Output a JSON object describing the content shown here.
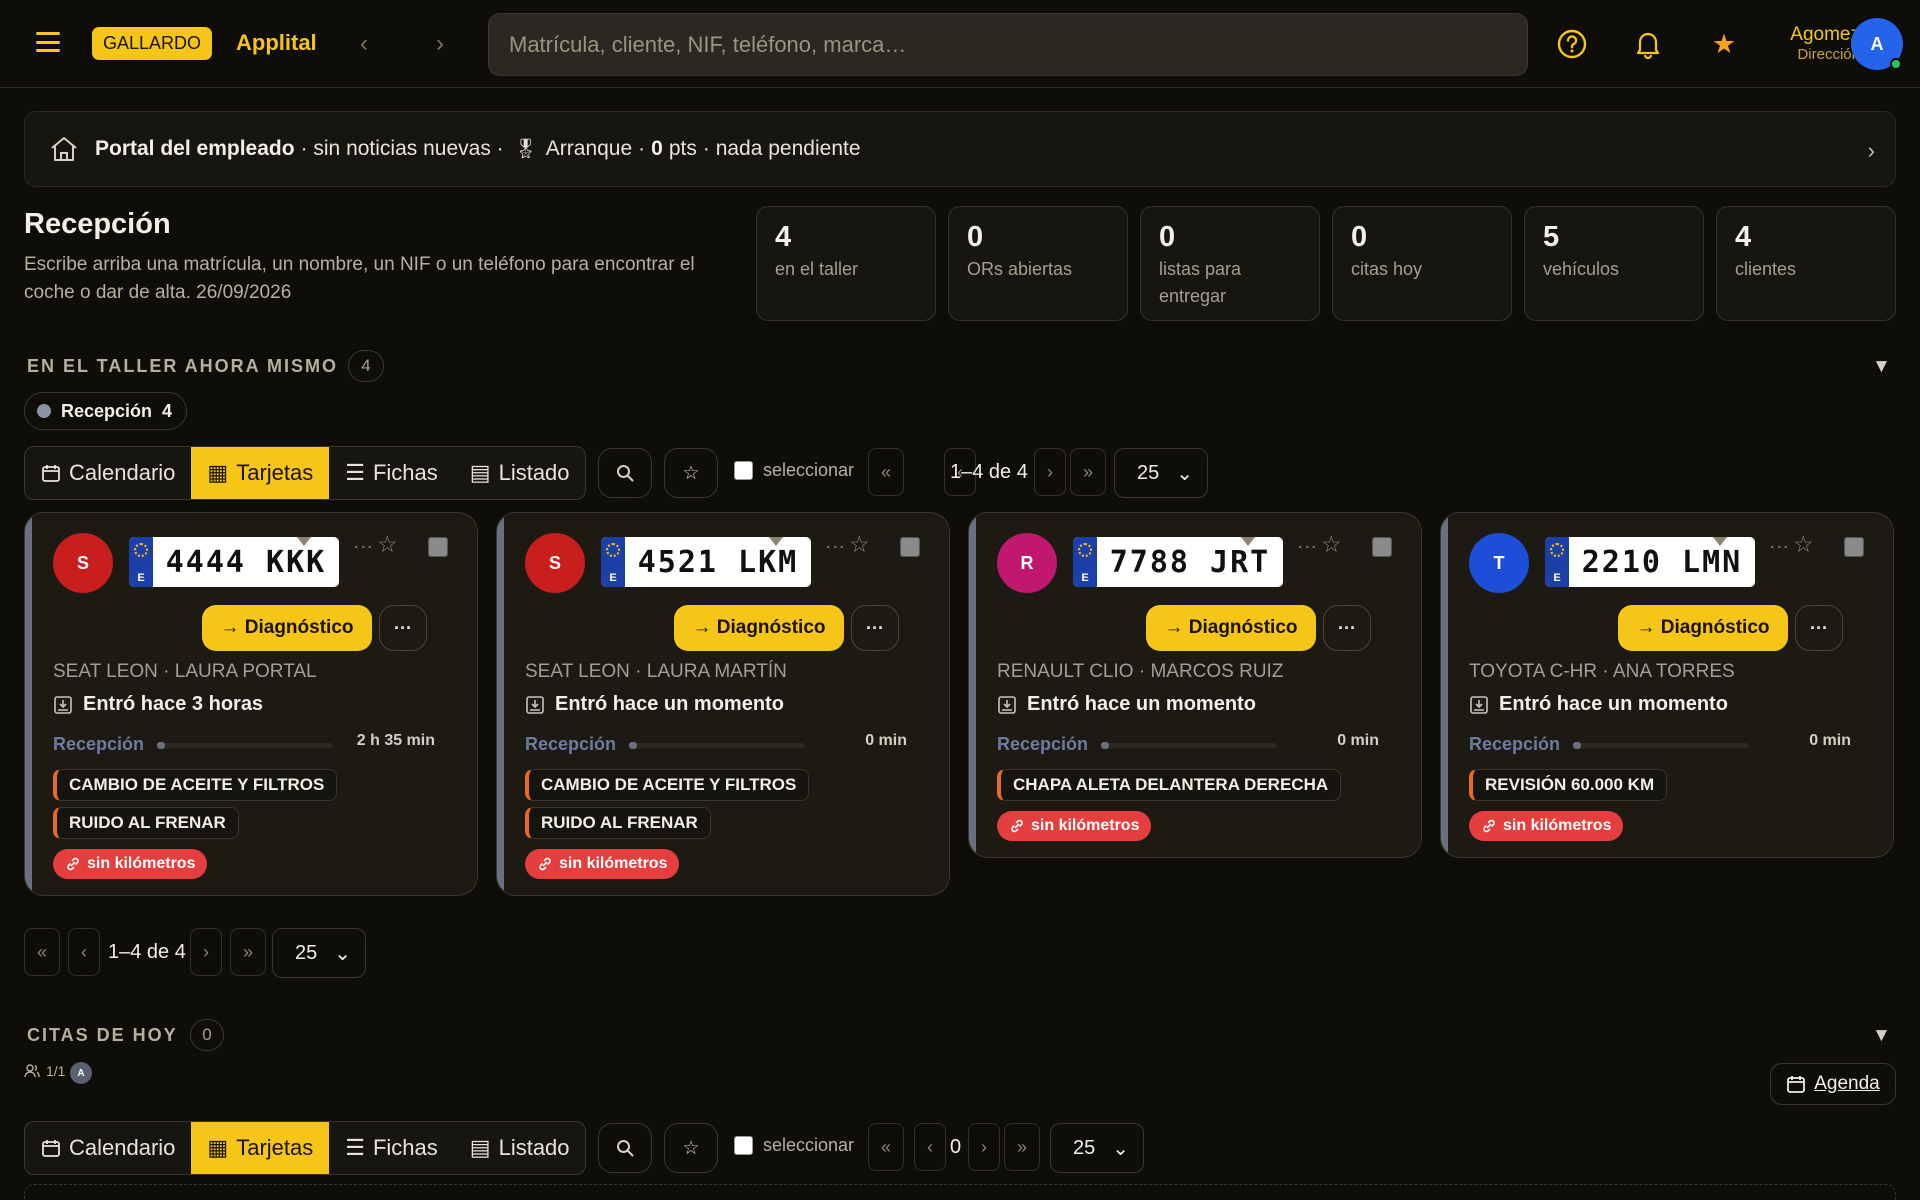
{
  "header": {
    "brand_badge": "GALLARDO",
    "app_name": "Applital",
    "search_placeholder": "Matrícula, cliente, NIF, teléfono, marca…",
    "user_name": "Agomez",
    "user_role": "Dirección",
    "user_initial": "A"
  },
  "portal": {
    "title": "Portal del empleado",
    "news": "· sin noticias nuevas ·",
    "rank": "Arranque",
    "points_value": "0",
    "points_suffix": "pts",
    "pending": "· nada pendiente"
  },
  "reception": {
    "title": "Recepción",
    "description": "Escribe arriba una matrícula, un nombre, un NIF o un teléfono para encontrar el coche o dar de alta. 26/09/2026"
  },
  "stats": [
    {
      "value": "4",
      "label": "en el taller"
    },
    {
      "value": "0",
      "label": "ORs abiertas"
    },
    {
      "value": "0",
      "label": "listas para entregar"
    },
    {
      "value": "0",
      "label": "citas hoy"
    },
    {
      "value": "5",
      "label": "vehículos"
    },
    {
      "value": "4",
      "label": "clientes"
    }
  ],
  "section_workshop": {
    "title": "EN EL TALLER AHORA MISMO",
    "count": "4",
    "status_chip": {
      "label": "Recepción",
      "count": "4"
    }
  },
  "view_modes": [
    "Calendario",
    "Tarjetas",
    "Fichas",
    "Listado"
  ],
  "active_view": "Tarjetas",
  "toolbar": {
    "select_label": "seleccionar",
    "range_text": "1–4 de 4",
    "page_size": "25",
    "first": "«",
    "prev": "‹",
    "next": "›",
    "last": "»"
  },
  "cards": [
    {
      "initial": "S",
      "avatar_color": "#c81e1e",
      "plate": "4444 KKK",
      "action": "→ Diagnóstico",
      "vehicle": "SEAT LEON · LAURA PORTAL",
      "entry": "Entró hace 3 horas",
      "stage": "Recepción",
      "elapsed": "2 h 35 min",
      "tags": [
        "CAMBIO DE ACEITE Y FILTROS",
        "RUIDO AL FRENAR"
      ],
      "km_badge": "sin kilómetros"
    },
    {
      "initial": "S",
      "avatar_color": "#c81e1e",
      "plate": "4521 LKM",
      "action": "→ Diagnóstico",
      "vehicle": "SEAT LEON · LAURA MARTÍN",
      "entry": "Entró hace un momento",
      "stage": "Recepción",
      "elapsed": "0 min",
      "tags": [
        "CAMBIO DE ACEITE Y FILTROS",
        "RUIDO AL FRENAR"
      ],
      "km_badge": "sin kilómetros"
    },
    {
      "initial": "R",
      "avatar_color": "#c0186e",
      "plate": "7788 JRT",
      "action": "→ Diagnóstico",
      "vehicle": "RENAULT CLIO · MARCOS RUIZ",
      "entry": "Entró hace un momento",
      "stage": "Recepción",
      "elapsed": "0 min",
      "tags": [
        "CHAPA ALETA DELANTERA DERECHA"
      ],
      "km_badge": "sin kilómetros"
    },
    {
      "initial": "T",
      "avatar_color": "#1d4ed8",
      "plate": "2210 LMN",
      "action": "→ Diagnóstico",
      "vehicle": "TOYOTA C-HR · ANA TORRES",
      "entry": "Entró hace un momento",
      "stage": "Recepción",
      "elapsed": "0 min",
      "tags": [
        "REVISIÓN 60.000 KM"
      ],
      "km_badge": "sin kilómetros"
    }
  ],
  "section_appointments": {
    "title": "CITAS DE HOY",
    "count": "0",
    "staff_count": "1/1",
    "staff_initial": "A",
    "agenda_label": "Agenda",
    "range_text": "0",
    "page_size": "25"
  },
  "colors": {
    "accent": "#f5c518",
    "background": "#0f0d08",
    "danger": "#e53e3e",
    "tag_border": "#ea6a1f"
  }
}
